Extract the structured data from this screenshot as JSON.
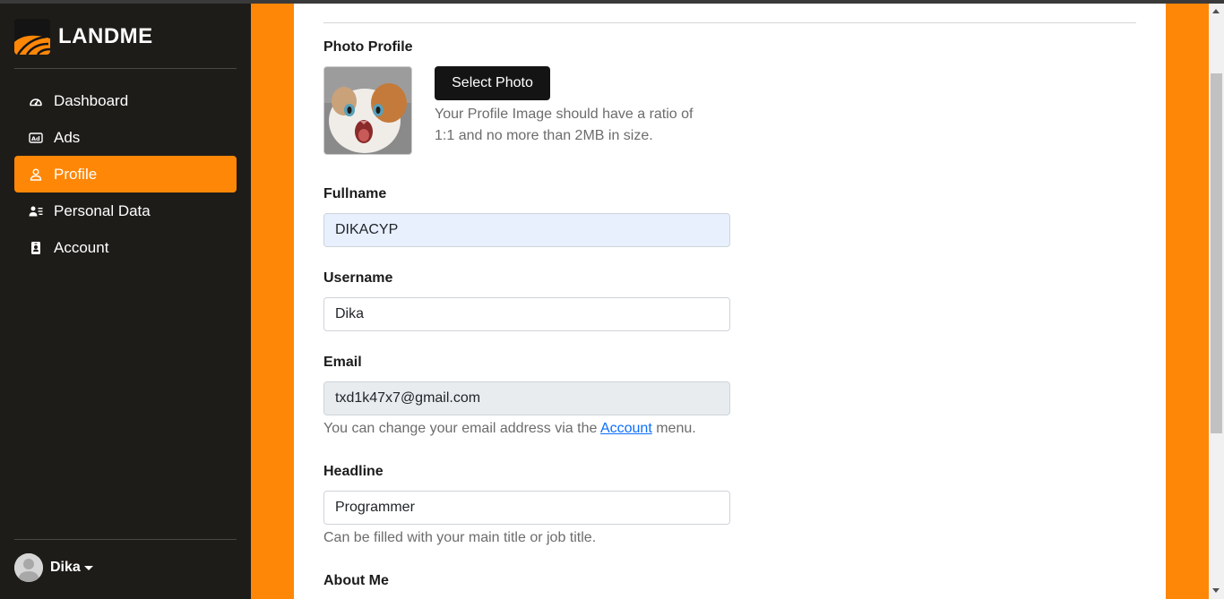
{
  "brand": {
    "name": "LANDME"
  },
  "sidebar": {
    "items": [
      {
        "label": "Dashboard",
        "icon": "dashboard-gauge-icon",
        "active": false
      },
      {
        "label": "Ads",
        "icon": "ad-icon",
        "active": false
      },
      {
        "label": "Profile",
        "icon": "person-icon",
        "active": true
      },
      {
        "label": "Personal Data",
        "icon": "person-lines-icon",
        "active": false
      },
      {
        "label": "Account",
        "icon": "badge-icon",
        "active": false
      }
    ],
    "user": {
      "name": "Dika"
    }
  },
  "colors": {
    "accent": "#ff8707",
    "sidebar_bg": "#1e1c19",
    "link": "#0d6efd"
  },
  "form": {
    "photo": {
      "label": "Photo Profile",
      "button": "Select Photo",
      "help_line1": "Your Profile Image should have a ratio of",
      "help_line2": "1:1 and no more than 2MB in size."
    },
    "fullname": {
      "label": "Fullname",
      "value": "DIKACYP"
    },
    "username": {
      "label": "Username",
      "value": "Dika"
    },
    "email": {
      "label": "Email",
      "value": "txd1k47x7@gmail.com",
      "help_before": "You can change your email address via the ",
      "help_link": "Account",
      "help_after": " menu."
    },
    "headline": {
      "label": "Headline",
      "value": "Programmer",
      "help": "Can be filled with your main title or job title."
    },
    "about": {
      "label": "About Me"
    }
  }
}
